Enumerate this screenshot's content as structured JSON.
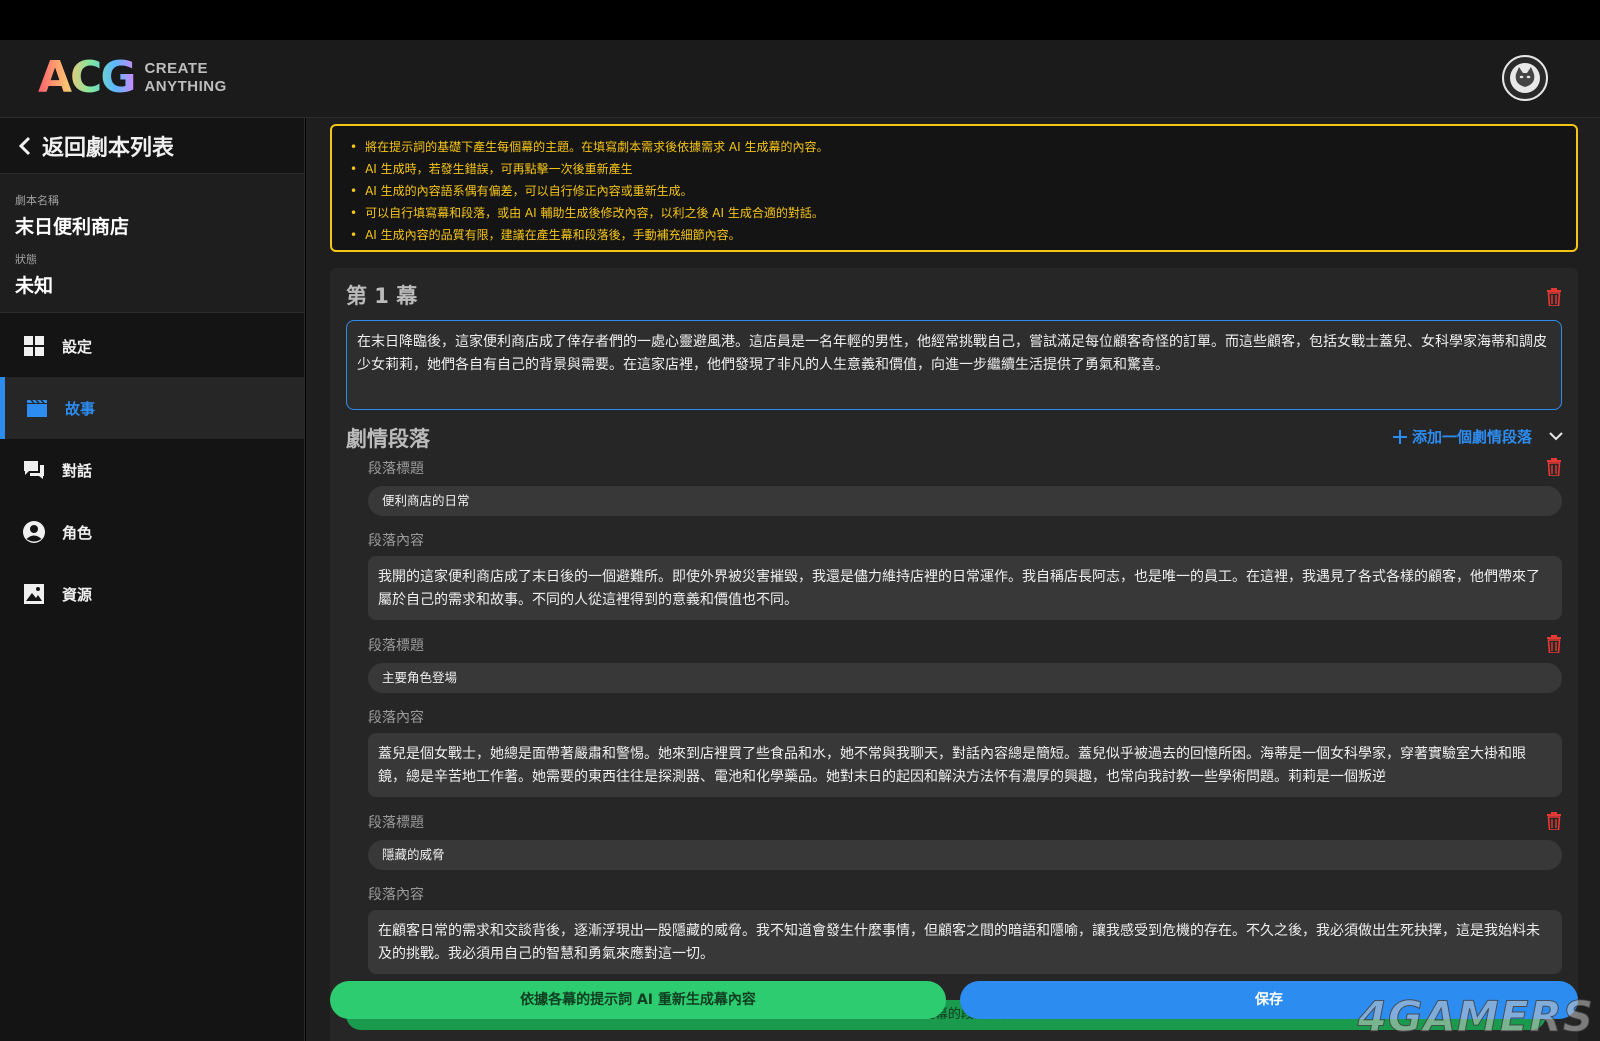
{
  "header": {
    "logo_mark": "ACG",
    "logo_line1": "CREATE",
    "logo_line2": "ANYTHING"
  },
  "sidebar": {
    "back_label": "返回劇本列表",
    "script_name_label": "劇本名稱",
    "script_name": "末日便利商店",
    "status_label": "狀態",
    "status": "未知",
    "nav": [
      {
        "label": "設定",
        "icon": "grid-icon"
      },
      {
        "label": "故事",
        "icon": "clapperboard-icon"
      },
      {
        "label": "對話",
        "icon": "chat-icon"
      },
      {
        "label": "角色",
        "icon": "person-icon"
      },
      {
        "label": "資源",
        "icon": "image-icon"
      }
    ],
    "active_index": 1
  },
  "notice": [
    "將在提示詞的基礎下產生每個幕的主題。在填寫劇本需求後依據需求 AI 生成幕的內容。",
    "AI 生成時，若發生錯誤，可再點擊一次後重新產生",
    "AI 生成的內容語系偶有偏差，可以自行修正內容或重新生成。",
    "可以自行填寫幕和段落，或由 AI 輔助生成後修改內容，以利之後 AI 生成合適的對話。",
    "AI 生成內容的品質有限，建議在產生幕和段落後，手動補充細節內容。"
  ],
  "act": {
    "title": "第 1 幕",
    "text": "在末日降臨後，這家便利商店成了倖存者們的一處心靈避風港。這店員是一名年輕的男性，他經常挑戰自己，嘗試滿足每位顧客奇怪的訂單。而這些顧客，包括女戰士蓋兒、女科學家海蒂和調皮少女莉莉，她們各自有自己的背景與需要。在這家店裡，他們發現了非凡的人生意義和價值，向進一步繼續生活提供了勇氣和驚喜。",
    "section_title": "劇情段落",
    "add_label": "添加一個劇情段落"
  },
  "paragraphs": [
    {
      "title_label": "段落標題",
      "title": "便利商店的日常",
      "content_label": "段落內容",
      "content": "我開的這家便利商店成了末日後的一個避難所。即使外界被災害摧毀，我還是儘力維持店裡的日常運作。我自稱店長阿志，也是唯一的員工。在這裡，我遇見了各式各樣的顧客，他們帶來了屬於自己的需求和故事。不同的人從這裡得到的意義和價值也不同。"
    },
    {
      "title_label": "段落標題",
      "title": "主要角色登場",
      "content_label": "段落內容",
      "content": "蓋兒是個女戰士，她總是面帶著嚴肅和警惕。她來到店裡買了些食品和水，她不常與我聊天，對話內容總是簡短。蓋兒似乎被過去的回憶所困。海蒂是一個女科學家，穿著實驗室大褂和眼鏡，總是辛苦地工作著。她需要的東西往往是探測器、電池和化學藥品。她對末日的起因和解決方法怀有濃厚的興趣，也常向我討教一些學術問題。莉莉是一個叛逆"
    },
    {
      "title_label": "段落標題",
      "title": "隱藏的威脅",
      "content_label": "段落內容",
      "content": "在顧客日常的需求和交談背後，逐漸浮現出一股隱藏的威脅。我不知道會發生什麼事情，但顧客之間的暗語和隱喻，讓我感受到危機的存在。不久之後，我必須做出生死抉擇，這是我始料未及的挑戰。我必須用自己的智慧和勇氣來應對這一切。"
    }
  ],
  "footer": {
    "regen_label": "依據各幕的提示詞 AI 重新生成幕內容",
    "under_label": "AI 生成此幕的段落內容",
    "save_label": "保存"
  },
  "watermark": "4GAMERS",
  "colors": {
    "accent": "#2d8cf0",
    "notice": "#f5c518",
    "delete": "#e53935",
    "regen": "#2ecc71"
  }
}
